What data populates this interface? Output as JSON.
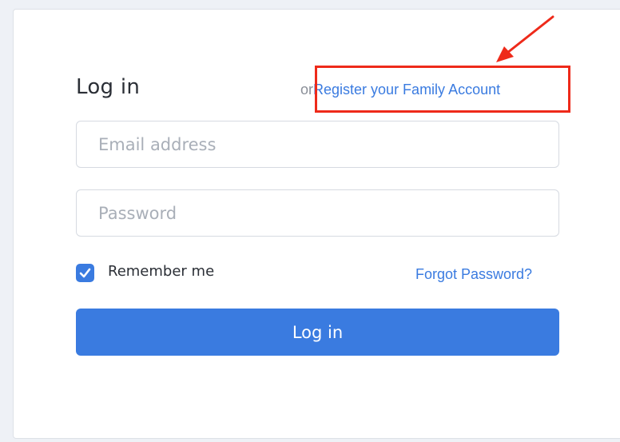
{
  "form": {
    "title": "Log in",
    "or_text": "or",
    "register_link": "Register your Family Account",
    "email": {
      "value": "",
      "placeholder": "Email address"
    },
    "password": {
      "value": "",
      "placeholder": "Password"
    },
    "remember_me": {
      "label": "Remember me",
      "checked": true
    },
    "forgot_password": "Forgot Password?",
    "submit_label": "Log in"
  },
  "annotation": {
    "box_color": "#ee2a1a",
    "arrow_color": "#ee2a1a"
  },
  "colors": {
    "accent": "#3a7be0",
    "text": "#2b2f36",
    "placeholder": "#a9afb8"
  }
}
